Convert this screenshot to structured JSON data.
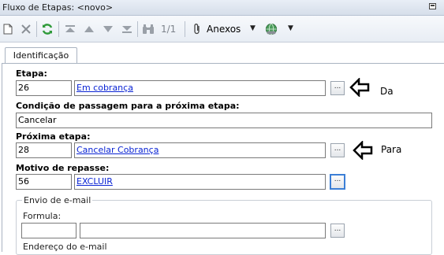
{
  "window": {
    "title": "Fluxo de Etapas: <novo>"
  },
  "toolbar": {
    "icons": [
      "new-icon",
      "delete-icon",
      "refresh-icon",
      "first-icon",
      "prev-icon",
      "next-icon",
      "last-icon",
      "binoculars-icon"
    ],
    "record_position": "1/1",
    "attachments_label": "Anexos",
    "web_icon": "globe-icon"
  },
  "tabs": [
    {
      "label": "Identificação"
    }
  ],
  "form": {
    "etapa": {
      "label": "Etapa:",
      "code": "26",
      "description": "Em cobrança "
    },
    "condicao": {
      "label": "Condição de passagem para a próxima etapa:",
      "value": "Cancelar"
    },
    "proxima_etapa": {
      "label": "Próxima etapa:",
      "code": "28",
      "description": "Cancelar Cobrança"
    },
    "motivo": {
      "label": "Motivo de repasse:",
      "code": "56",
      "description": "EXCLUIR"
    },
    "lookup_button": "...",
    "email": {
      "legend": "Envio de e-mail",
      "formula_label": "Formula:",
      "formula_code": "",
      "formula_description": "",
      "next_label": "Endereço do e-mail"
    }
  },
  "annotations": {
    "from": "Da",
    "to": "Para"
  },
  "colors": {
    "link": "#0a24d4",
    "focus_border": "#3c7fd6"
  }
}
